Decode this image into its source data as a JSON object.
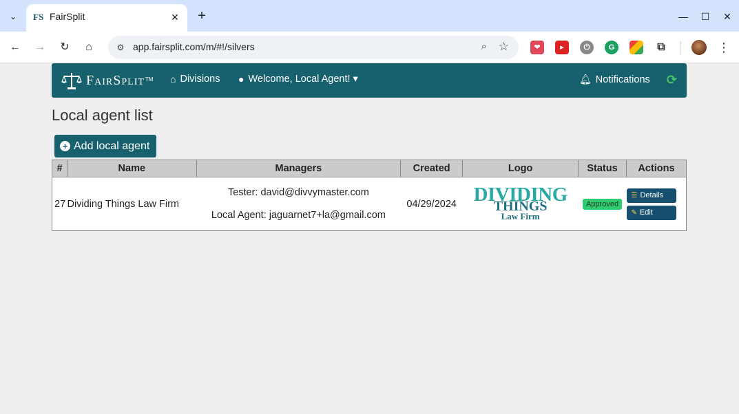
{
  "browser": {
    "tab_title": "FairSplit",
    "tab_favicon": "FS",
    "url": "app.fairsplit.com/m/#!/silvers"
  },
  "navbar": {
    "brand": "FairSplit",
    "brand_tm": "TM",
    "divisions_label": "Divisions",
    "welcome_label": "Welcome, Local Agent! ▾",
    "notifications_label": "Notifications"
  },
  "page": {
    "title": "Local agent list",
    "add_button_label": "Add local agent"
  },
  "table": {
    "headers": [
      "#",
      "Name",
      "Managers",
      "Created",
      "Logo",
      "Status",
      "Actions"
    ],
    "rows": [
      {
        "num": "27",
        "name": "Dividing Things Law Firm",
        "managers": [
          "Tester: david@divvymaster.com",
          "Local Agent: jaguarnet7+la@gmail.com"
        ],
        "created": "04/29/2024",
        "logo": {
          "line1": "DIVIDING",
          "line2": "THINGS",
          "line3": "Law Firm"
        },
        "status": "Approved",
        "actions": [
          "Details",
          "Edit"
        ]
      }
    ]
  },
  "colors": {
    "navbar": "#17606e",
    "approved": "#2ecc71",
    "refresh": "#46c46a"
  }
}
